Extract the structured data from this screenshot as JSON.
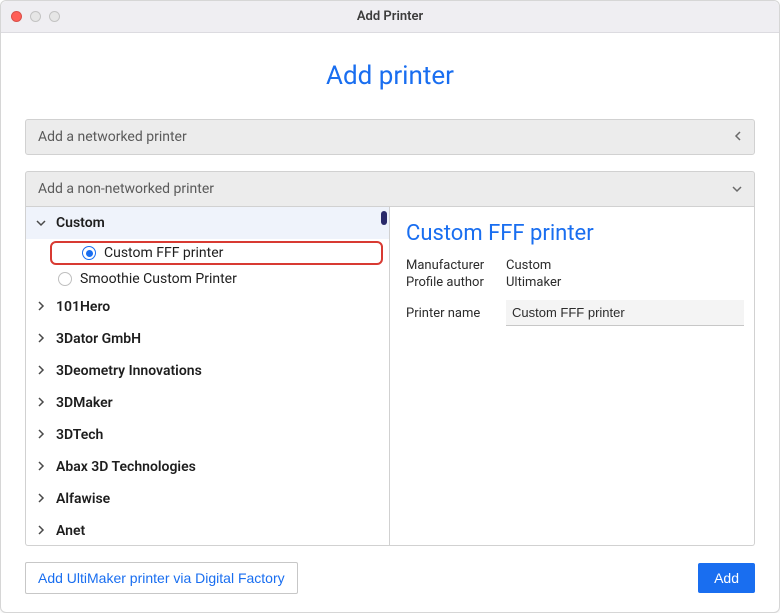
{
  "window": {
    "title": "Add Printer"
  },
  "page": {
    "title": "Add printer"
  },
  "sections": {
    "networked": {
      "label": "Add a networked printer"
    },
    "nonnetworked": {
      "label": "Add a non-networked printer"
    }
  },
  "tree": {
    "expandedGroup": "Custom",
    "children": [
      {
        "label": "Custom FFF printer",
        "selected": true
      },
      {
        "label": "Smoothie Custom Printer",
        "selected": false
      }
    ],
    "groups": [
      "101Hero",
      "3Dator GmbH",
      "3Deometry Innovations",
      "3DMaker",
      "3DTech",
      "Abax 3D Technologies",
      "Alfawise",
      "Anet"
    ]
  },
  "details": {
    "title": "Custom FFF printer",
    "manufacturer_label": "Manufacturer",
    "manufacturer_value": "Custom",
    "author_label": "Profile author",
    "author_value": "Ultimaker",
    "pname_label": "Printer name",
    "pname_value": "Custom FFF printer"
  },
  "buttons": {
    "digital_factory": "Add UltiMaker printer via Digital Factory",
    "add": "Add"
  }
}
